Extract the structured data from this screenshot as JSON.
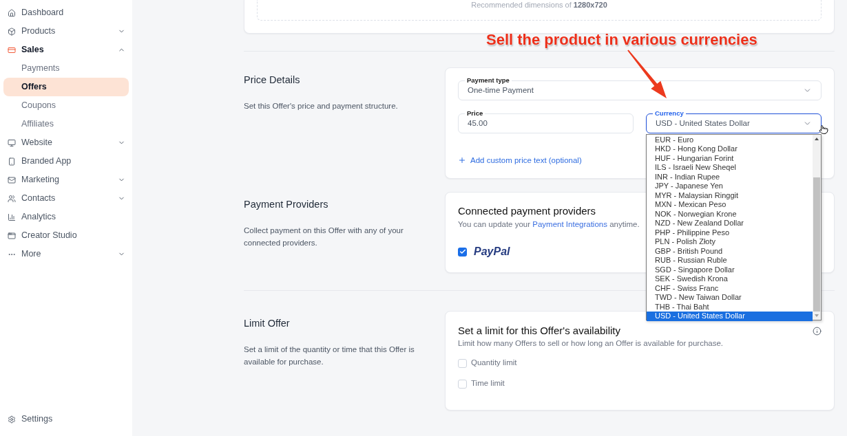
{
  "sidebar": {
    "items": [
      {
        "label": "Dashboard",
        "kind": "link",
        "selected": false
      },
      {
        "label": "Products",
        "kind": "group",
        "expanded": false,
        "selected": false
      },
      {
        "label": "Sales",
        "kind": "group",
        "expanded": true,
        "selected": true,
        "children": [
          {
            "label": "Payments",
            "selected": false
          },
          {
            "label": "Offers",
            "selected": true
          },
          {
            "label": "Coupons",
            "selected": false
          },
          {
            "label": "Affiliates",
            "selected": false
          }
        ]
      },
      {
        "label": "Website",
        "kind": "group",
        "expanded": false,
        "selected": false
      },
      {
        "label": "Branded App",
        "kind": "link",
        "selected": false
      },
      {
        "label": "Marketing",
        "kind": "group",
        "expanded": false,
        "selected": false
      },
      {
        "label": "Contacts",
        "kind": "group",
        "expanded": false,
        "selected": false
      },
      {
        "label": "Analytics",
        "kind": "link",
        "selected": false
      },
      {
        "label": "Creator Studio",
        "kind": "link",
        "selected": false
      },
      {
        "label": "More",
        "kind": "group",
        "expanded": false,
        "selected": false
      }
    ],
    "footer": {
      "label": "Settings"
    }
  },
  "media_card": {
    "hint": "Recommended dimensions of **1280x720**"
  },
  "price_section": {
    "title": "Price Details",
    "description": "Set this Offer's price and payment structure.",
    "payment_type": {
      "label": "Payment type",
      "value": "One-time Payment"
    },
    "price": {
      "label": "Price",
      "value": "45.00"
    },
    "currency": {
      "label": "Currency",
      "value": "USD - United States Dollar",
      "focused": true,
      "expanded": true,
      "options": [
        {
          "label": "EUR - Euro",
          "selected": false
        },
        {
          "label": "HKD - Hong Kong Dollar",
          "selected": false
        },
        {
          "label": "HUF - Hungarian Forint",
          "selected": false
        },
        {
          "label": "ILS - Israeli New Sheqel",
          "selected": false
        },
        {
          "label": "INR - Indian Rupee",
          "selected": false
        },
        {
          "label": "JPY - Japanese Yen",
          "selected": false
        },
        {
          "label": "MYR - Malaysian Ringgit",
          "selected": false
        },
        {
          "label": "MXN - Mexican Peso",
          "selected": false
        },
        {
          "label": "NOK - Norwegian Krone",
          "selected": false
        },
        {
          "label": "NZD - New Zealand Dollar",
          "selected": false
        },
        {
          "label": "PHP - Philippine Peso",
          "selected": false
        },
        {
          "label": "PLN - Polish Złoty",
          "selected": false
        },
        {
          "label": "GBP - British Pound",
          "selected": false
        },
        {
          "label": "RUB - Russian Ruble",
          "selected": false
        },
        {
          "label": "SGD - Singapore Dollar",
          "selected": false
        },
        {
          "label": "SEK - Swedish Krona",
          "selected": false
        },
        {
          "label": "CHF - Swiss Franc",
          "selected": false
        },
        {
          "label": "TWD - New Taiwan Dollar",
          "selected": false
        },
        {
          "label": "THB - Thai Baht",
          "selected": false
        },
        {
          "label": "USD - United States Dollar",
          "selected": true
        }
      ]
    },
    "add_price_text": {
      "label": "Add custom price text (optional)"
    }
  },
  "payment_section": {
    "title": "Payment Providers",
    "description": "Collect payment on this Offer with any of your connected providers.",
    "card_title": "Connected payment providers",
    "card_text": {
      "before": "You can update your",
      "link": "Payment Integrations",
      "after": "anytime."
    },
    "providers": [
      {
        "name": "PayPal",
        "checked": true
      }
    ]
  },
  "limit_section": {
    "title": "Limit Offer",
    "description": "Set a limit of the quantity or time that this Offer is available for purchase.",
    "card_title": "Set a limit for this Offer's availability",
    "card_text": "Limit how many Offers to sell or how long an Offer is available for purchase.",
    "options": [
      {
        "label": "Quantity limit",
        "checked": false
      },
      {
        "label": "Time limit",
        "checked": false
      }
    ]
  },
  "annotation": {
    "text": "Sell the product in various currencies"
  }
}
